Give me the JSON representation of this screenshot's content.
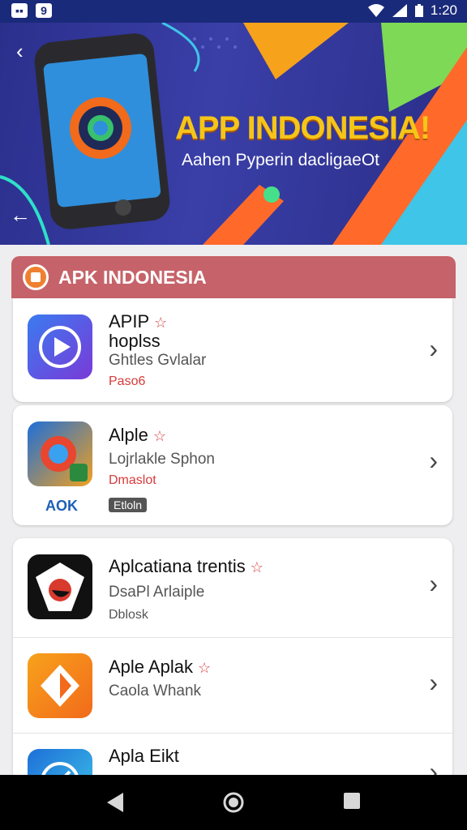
{
  "status_bar": {
    "left_icons": [
      "message-icon",
      "9"
    ],
    "time": "1:20"
  },
  "banner": {
    "title": "APP INDONESIA!",
    "subtitle": "Aahen Pyperin dacligaeOt"
  },
  "section": {
    "title": "APK INDONESIA"
  },
  "apps": [
    {
      "title_line1": "APIP",
      "title_line2": "hoplss",
      "subtitle": "Ghtles Gvlalar",
      "tag": "Paso6"
    },
    {
      "title": "Alple",
      "subtitle": "Lojrlakle Sphon",
      "tag": "Dmaslot",
      "badge": "Etloln",
      "icon_caption": "AOK"
    },
    {
      "title": "Aplcatiana trentis",
      "subtitle": "DsaPl Arlaiple",
      "tag": "Dblosk"
    },
    {
      "title": "Aple Aplak",
      "subtitle": "Caola Whank"
    },
    {
      "title": "Apla Eikt"
    }
  ],
  "colors": {
    "status_bar": "#1a2a7a",
    "banner_bg": "#2b2f8c",
    "banner_title": "#f5c518",
    "section_header": "#c6636a",
    "star": "#d64040",
    "tag_red": "#d83a3a"
  },
  "nav_bar": {
    "buttons": [
      "back-icon",
      "home-icon",
      "recents-icon"
    ]
  }
}
